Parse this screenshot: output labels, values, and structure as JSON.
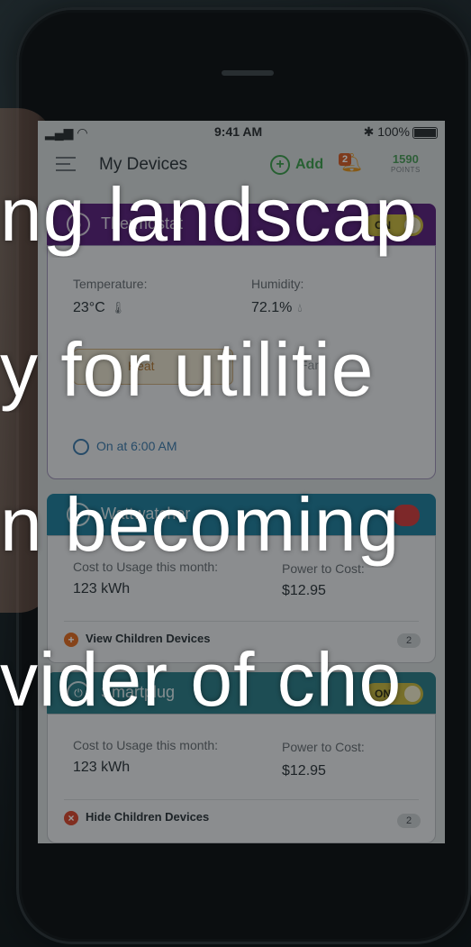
{
  "status_bar": {
    "time": "9:41 AM",
    "battery": "100%"
  },
  "header": {
    "title": "My Devices",
    "add_label": "Add",
    "notification_count": "2",
    "points_value": "1590",
    "points_label": "POINTS"
  },
  "thermostat": {
    "name": "Thermostat",
    "toggle": "ON",
    "temp_label": "Temperature:",
    "temp_value": "23°C",
    "humidity_label": "Humidity:",
    "humidity_value": "72.1%",
    "heat_label": "Heat",
    "fan_label": "Fan",
    "schedule": "On at 6:00 AM"
  },
  "wattwatcher": {
    "name": "Wattwatcher",
    "cost_label": "Cost to Usage this month:",
    "cost_value": "123 kWh",
    "power_label": "Power to Cost:",
    "power_value": "$12.95",
    "children_label": "View Children Devices",
    "children_count": "2"
  },
  "smartplug": {
    "name": "Smartplug",
    "toggle": "ON",
    "cost_label": "Cost to Usage this month:",
    "cost_value": "123 kWh",
    "power_label": "Power to Cost:",
    "power_value": "$12.95",
    "children_label": "Hide Children Devices",
    "children_count": "2"
  },
  "overlay": {
    "line1": "ng landscap",
    "line2": "y for utilitie",
    "line3": "n becoming",
    "line4": "vider of cho"
  },
  "colors": {
    "thermostat": "#5a1f7a",
    "wattwatcher": "#1f7d9a",
    "smartplug": "#2b7a86",
    "accent_green": "#3d9c4a"
  }
}
